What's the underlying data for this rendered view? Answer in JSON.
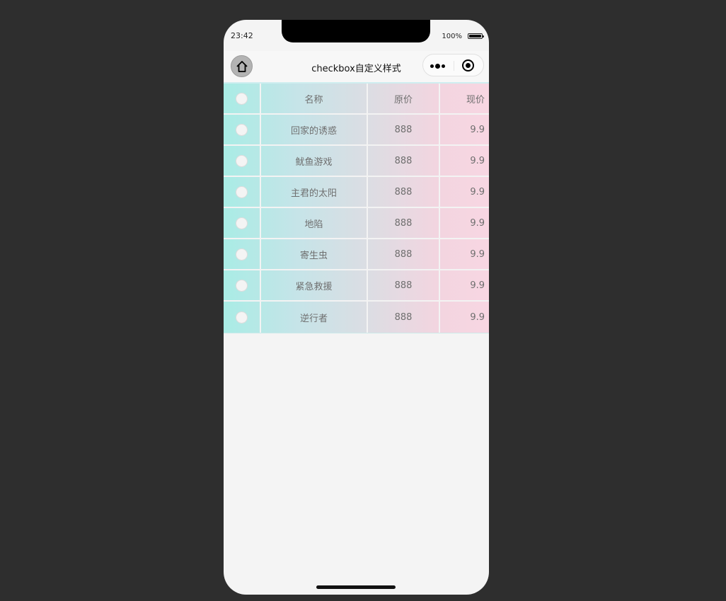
{
  "status_bar": {
    "time": "23:42",
    "battery": "100%"
  },
  "navbar": {
    "title": "checkbox自定义样式",
    "home_icon": "home-icon",
    "more_icon": "more-dots-icon",
    "close_icon": "target-circle-icon"
  },
  "table": {
    "headers": {
      "check": "",
      "name": "名称",
      "original_price": "原价",
      "current_price": "现价"
    },
    "rows": [
      {
        "name": "回家的诱惑",
        "original_price": "888",
        "current_price": "9.9",
        "checked": false
      },
      {
        "name": "鱿鱼游戏",
        "original_price": "888",
        "current_price": "9.9",
        "checked": false
      },
      {
        "name": "主君的太阳",
        "original_price": "888",
        "current_price": "9.9",
        "checked": false
      },
      {
        "name": "地陷",
        "original_price": "888",
        "current_price": "9.9",
        "checked": false
      },
      {
        "name": "寄生虫",
        "original_price": "888",
        "current_price": "9.9",
        "checked": false
      },
      {
        "name": "紧急救援",
        "original_price": "888",
        "current_price": "9.9",
        "checked": false
      },
      {
        "name": "逆行者",
        "original_price": "888",
        "current_price": "9.9",
        "checked": false
      }
    ]
  },
  "colors": {
    "table_start": "#a9ece5",
    "table_end": "#f8d6e2",
    "page_bg": "#2e2e2e"
  }
}
